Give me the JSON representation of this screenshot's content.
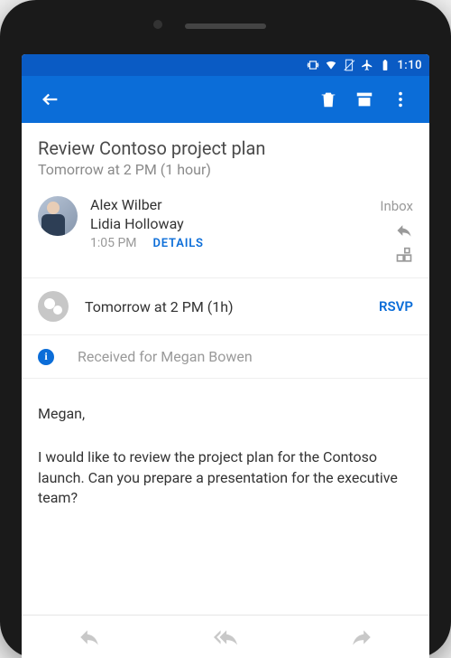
{
  "status": {
    "time": "1:10"
  },
  "subject": {
    "title": "Review Contoso project plan",
    "subtitle": "Tomorrow at 2 PM (1 hour)"
  },
  "sender": {
    "name": "Alex Wilber",
    "recipient": "Lidia Holloway",
    "time": "1:05 PM",
    "details": "DETAILS",
    "folder": "Inbox"
  },
  "event": {
    "time": "Tomorrow at 2 PM (1h)",
    "rsvp": "RSVP"
  },
  "info": {
    "text": "Received for Megan Bowen"
  },
  "body": {
    "salutation": "Megan,",
    "text": "I would like to review the project plan for the Contoso launch. Can you prepare a presentation for the executive team?"
  },
  "colors": {
    "primary": "#0b6dd8",
    "statusbar": "#0a5bc4"
  }
}
